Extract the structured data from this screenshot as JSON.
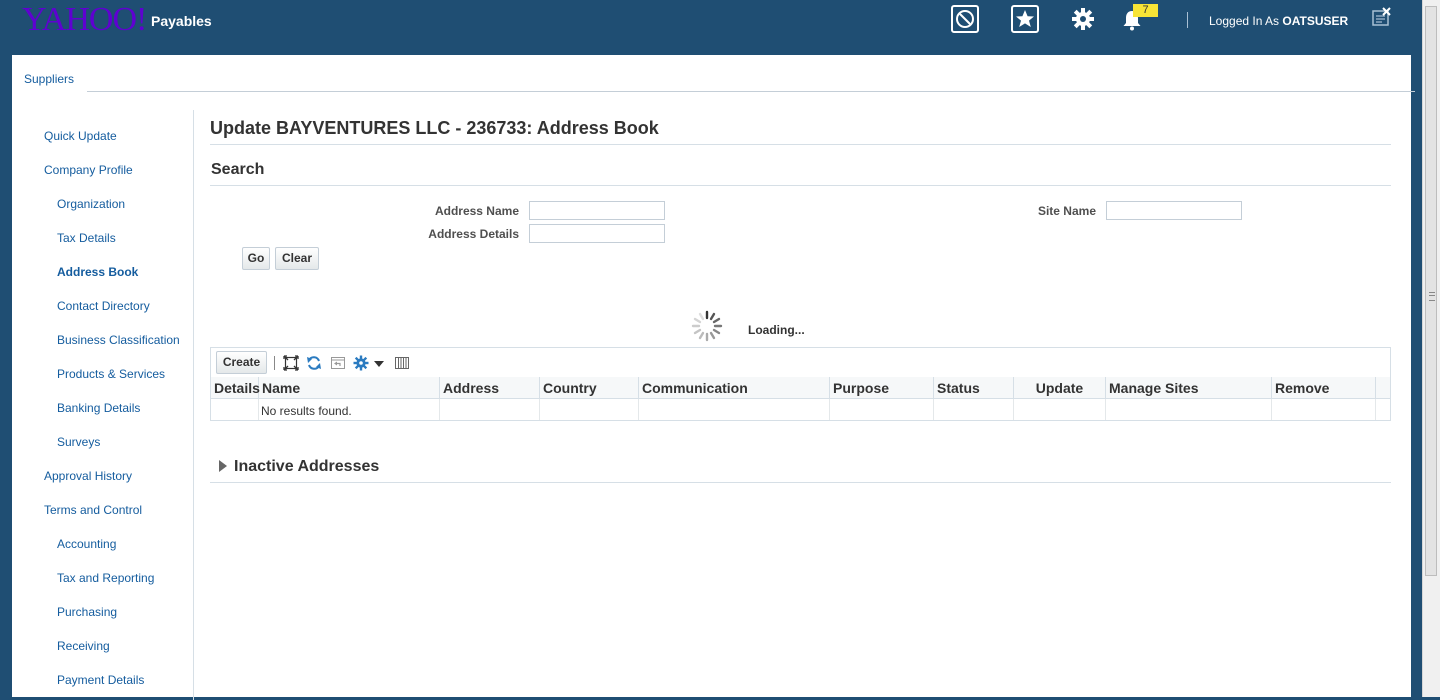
{
  "header": {
    "logo_text": "YAHOO!",
    "app_title": "Payables",
    "notification_count": "7",
    "logged_in_prefix": "Logged In As",
    "username": "OATSUSER"
  },
  "tabs": {
    "suppliers": "Suppliers"
  },
  "sidebar": {
    "items": [
      {
        "label": "Quick Update"
      },
      {
        "label": "Company Profile"
      },
      {
        "label": "Organization"
      },
      {
        "label": "Tax Details"
      },
      {
        "label": "Address Book"
      },
      {
        "label": "Contact Directory"
      },
      {
        "label": "Business Classification"
      },
      {
        "label": "Products & Services"
      },
      {
        "label": "Banking Details"
      },
      {
        "label": "Surveys"
      },
      {
        "label": "Approval History"
      },
      {
        "label": "Terms and Control"
      },
      {
        "label": "Accounting"
      },
      {
        "label": "Tax and Reporting"
      },
      {
        "label": "Purchasing"
      },
      {
        "label": "Receiving"
      },
      {
        "label": "Payment Details"
      }
    ]
  },
  "main": {
    "page_title": "Update BAYVENTURES LLC - 236733: Address Book",
    "search": {
      "title": "Search",
      "address_name_label": "Address Name",
      "address_name_value": "",
      "address_details_label": "Address Details",
      "address_details_value": "",
      "site_name_label": "Site Name",
      "site_name_value": "",
      "go_label": "Go",
      "clear_label": "Clear"
    },
    "loading_text": "Loading...",
    "toolbar": {
      "create_label": "Create"
    },
    "table": {
      "columns": [
        "Details",
        "Name",
        "Address",
        "Country",
        "Communication",
        "Purpose",
        "Status",
        "Update",
        "Manage Sites",
        "Remove"
      ],
      "empty_message": "No results found."
    },
    "inactive_title": "Inactive Addresses"
  }
}
